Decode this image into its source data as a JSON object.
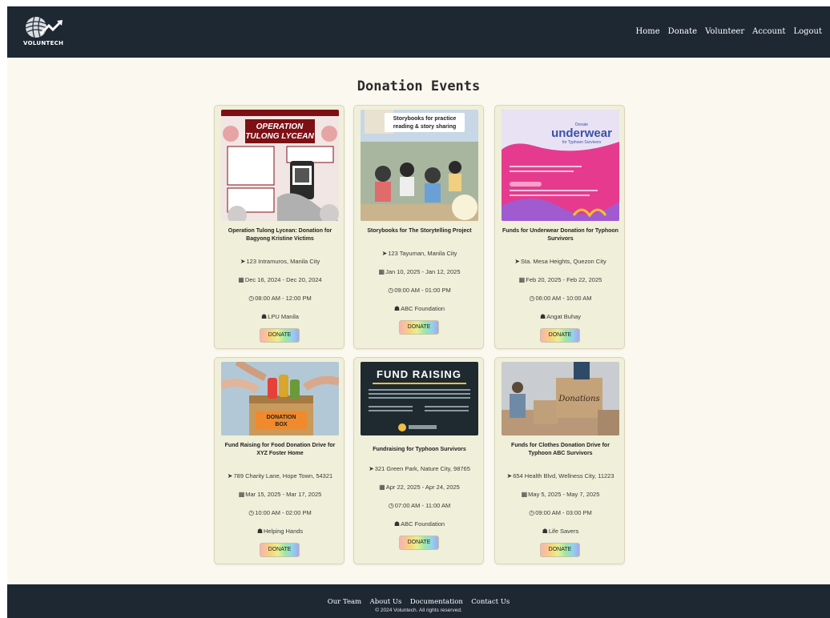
{
  "brand": {
    "name": "VOLUNTECH"
  },
  "nav": {
    "items": [
      "Home",
      "Donate",
      "Volunteer",
      "Account",
      "Logout"
    ]
  },
  "page": {
    "title": "Donation Events"
  },
  "events": [
    {
      "name": "Operation Tulong Lycean: Donation for Bagyong Kristine Victims",
      "location": "123 Intramuros, Manila City",
      "dates": "Dec 16, 2024 - Dec 20, 2024",
      "time": "08:00 AM - 12:00 PM",
      "organizer": "LPU Manila",
      "button": "DONATE",
      "poster": {
        "line1": "OPERATION",
        "line2": "TULONG LYCEAN"
      }
    },
    {
      "name": "Storybooks for The Storytelling Project",
      "location": "123 Tayuman, Manila City",
      "dates": "Jan 10, 2025 - Jan 12, 2025",
      "time": "09:00 AM - 01:00 PM",
      "organizer": "ABC Foundation",
      "button": "DONATE",
      "poster": {
        "line1": "Storybooks for practice",
        "line2": "reading & story sharing"
      }
    },
    {
      "name": "Funds for Underwear Donation for Typhoon Survivors",
      "location": "Sta. Mesa Heights, Quezon City",
      "dates": "Feb 20, 2025 - Feb 22, 2025",
      "time": "06:00 AM - 10:00 AM",
      "organizer": "Angat Buhay",
      "button": "DONATE",
      "poster": {
        "line1": "Donate",
        "line2": "underwear",
        "line3": "for Typhoon Survivors"
      }
    },
    {
      "name": "Fund Raising for Food Donation Drive for XYZ Foster Home",
      "location": "789 Charity Lane, Hope Town, 54321",
      "dates": "Mar 15, 2025 - Mar 17, 2025",
      "time": "10:00 AM - 02:00 PM",
      "organizer": "Helping Hands",
      "button": "DONATE",
      "poster": {
        "line1": "DONATION",
        "line2": "BOX"
      }
    },
    {
      "name": "Fundraising for Typhoon Survivors",
      "location": "321 Green Park, Nature City, 98765",
      "dates": "Apr 22, 2025 - Apr 24, 2025",
      "time": "07:00 AM - 11:00 AM",
      "organizer": "ABC Foundation",
      "button": "DONATE",
      "poster": {
        "line1": "FUND RAISING"
      }
    },
    {
      "name": "Funds for Clothes Donation Drive for Typhoon ABC Survivors",
      "location": "654 Health Blvd, Wellness City, 11223",
      "dates": "May 5, 2025 - May 7, 2025",
      "time": "09:00 AM - 03:00 PM",
      "organizer": "Life Savers",
      "button": "DONATE",
      "poster": {
        "line1": "Donations"
      }
    }
  ],
  "footer": {
    "links": [
      "Our Team",
      "About Us",
      "Documentation",
      "Contact Us"
    ],
    "copyright": "© 2024 Voluntech. All rights reserved."
  }
}
